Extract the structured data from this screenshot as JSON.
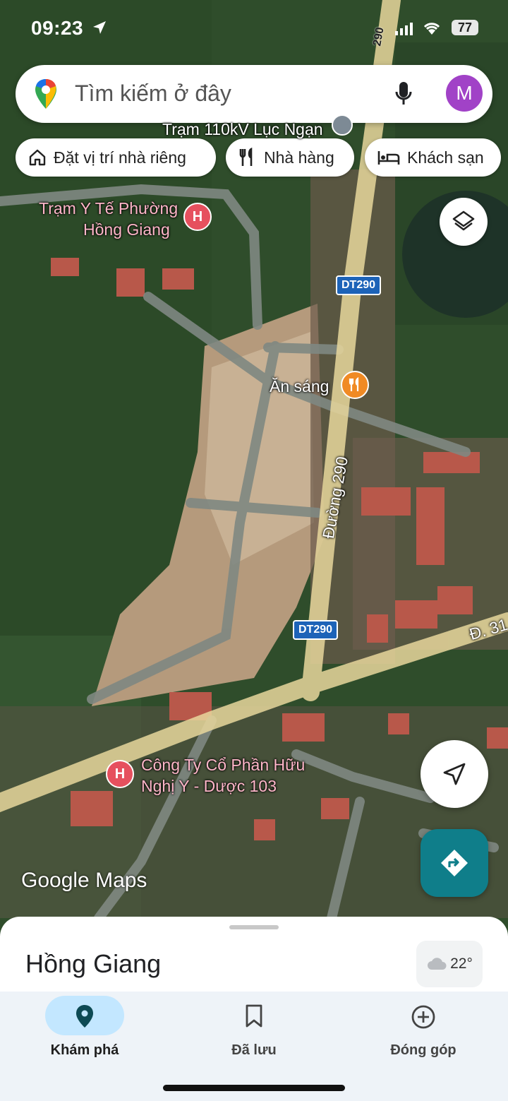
{
  "status_bar": {
    "time": "09:23",
    "battery": "77"
  },
  "search": {
    "placeholder": "Tìm kiếm ở đây",
    "avatar_letter": "M"
  },
  "chips": [
    {
      "label": "Đặt vị trí nhà riêng",
      "icon": "home-icon"
    },
    {
      "label": "Nhà hàng",
      "icon": "restaurant-icon"
    },
    {
      "label": "Khách sạn",
      "icon": "hotel-icon"
    }
  ],
  "map_labels": {
    "substation": "Trạm 110kV Lục Ngạn",
    "health_station_line1": "Trạm Y Tế Phường",
    "health_station_line2": "Hồng Giang",
    "breakfast": "Ăn sáng",
    "road_name": "Đường 290",
    "road_partial": "Đ. 31",
    "shield_1": "DT290",
    "shield_2": "DT290",
    "shield_top": "290",
    "company_line1": "Công Ty Cổ Phần Hữu",
    "company_line2": "Nghị Y - Dược 103"
  },
  "logo": "Google Maps",
  "sheet": {
    "place_name": "Hồng Giang",
    "temperature": "22°"
  },
  "tabs": [
    {
      "label": "Khám phá",
      "icon": "explore-pin-icon",
      "active": true
    },
    {
      "label": "Đã lưu",
      "icon": "bookmark-icon",
      "active": false
    },
    {
      "label": "Đóng góp",
      "icon": "add-circle-icon",
      "active": false
    }
  ],
  "colors": {
    "accent": "#0f7e8a",
    "avatar": "#a142c7",
    "active_tab": "#c3e7ff"
  }
}
